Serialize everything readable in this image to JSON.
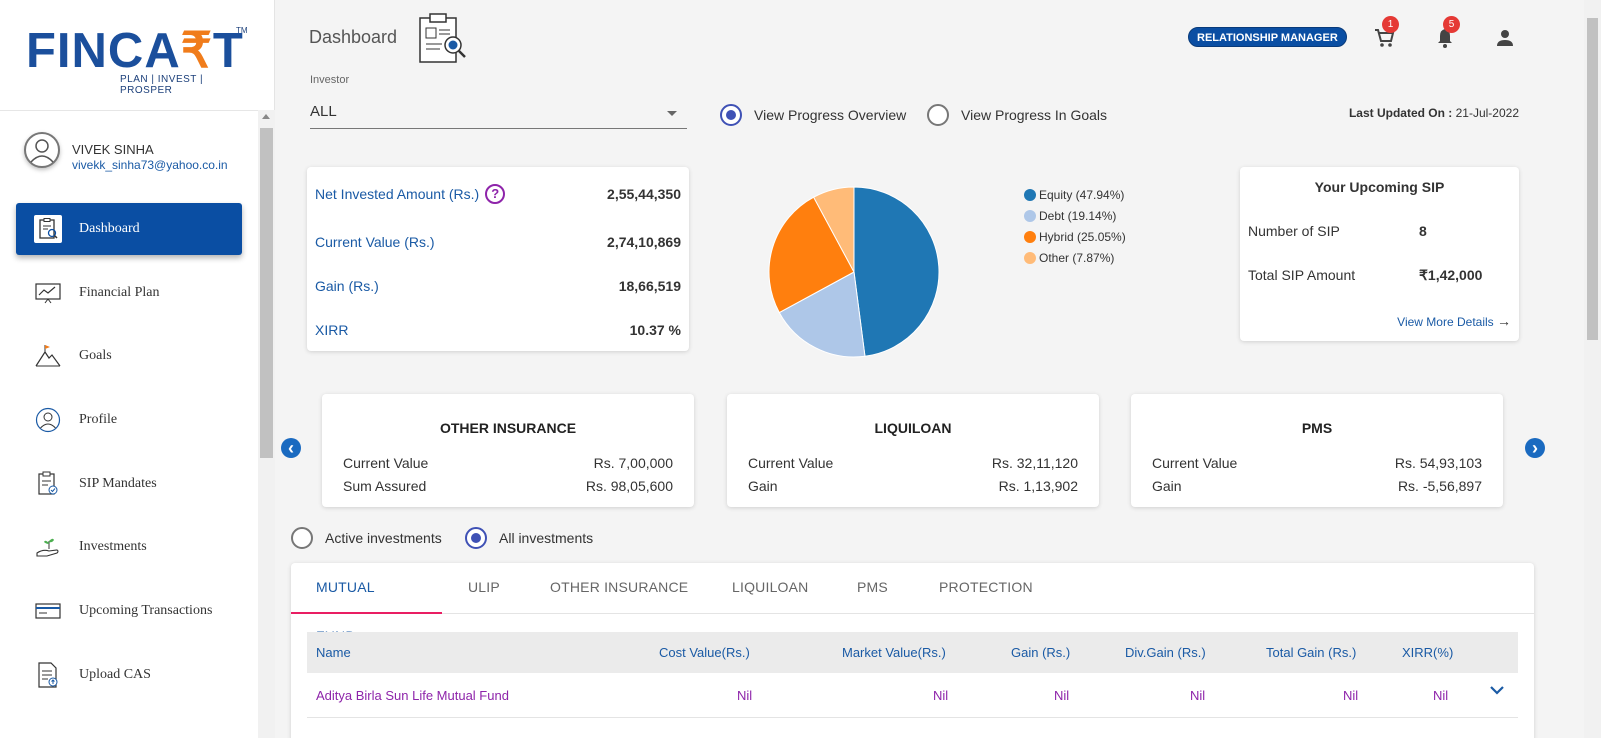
{
  "brand": {
    "name_part1": "FINCA",
    "name_rupee": "₹",
    "name_part2": "T",
    "tagline": "PLAN | INVEST | PROSPER",
    "tm": "TM",
    "primary_color": "#0a4ea3",
    "accent_color": "#f07c1b"
  },
  "user": {
    "name": "VIVEK SINHA",
    "email": "vivekk_sinha73@yahoo.co.in"
  },
  "sidebar": {
    "items": [
      {
        "label": "Dashboard",
        "icon": "dashboard-clipboard-icon",
        "active": true
      },
      {
        "label": "Financial Plan",
        "icon": "chart-board-icon"
      },
      {
        "label": "Goals",
        "icon": "mountain-flag-icon"
      },
      {
        "label": "Profile",
        "icon": "profile-icon"
      },
      {
        "label": "SIP Mandates",
        "icon": "clipboard-check-icon"
      },
      {
        "label": "Investments",
        "icon": "hand-plant-icon"
      },
      {
        "label": "Upcoming Transactions",
        "icon": "card-icon"
      },
      {
        "label": "Upload CAS",
        "icon": "document-upload-icon"
      }
    ]
  },
  "header": {
    "title": "Dashboard",
    "role_badge": "RELATIONSHIP MANAGER",
    "cart_count": "1",
    "notification_count": "5"
  },
  "investor": {
    "label": "Investor",
    "value": "ALL"
  },
  "view_options": {
    "overview": "View Progress Overview",
    "goals": "View Progress In Goals",
    "selected": "overview"
  },
  "last_updated": {
    "label": "Last Updated On :",
    "value": "21-Jul-2022"
  },
  "summary": {
    "rows": [
      {
        "label": "Net Invested Amount (Rs.)",
        "value": "2,55,44,350"
      },
      {
        "label": "Current Value (Rs.)",
        "value": "2,74,10,869"
      },
      {
        "label": "Gain (Rs.)",
        "value": "18,66,519"
      },
      {
        "label": "XIRR",
        "value": "10.37 %"
      }
    ],
    "help_symbol": "?"
  },
  "allocation": {
    "legend": [
      {
        "label": "Equity (47.94%)",
        "color": "#1f77b4"
      },
      {
        "label": "Debt (19.14%)",
        "color": "#aec7e8"
      },
      {
        "label": "Hybrid (25.05%)",
        "color": "#ff7f0e"
      },
      {
        "label": "Other (7.87%)",
        "color": "#ffbb78"
      }
    ]
  },
  "chart_data": {
    "type": "pie",
    "categories": [
      "Equity",
      "Debt",
      "Hybrid",
      "Other"
    ],
    "values": [
      47.94,
      19.14,
      25.05,
      7.87
    ],
    "colors": [
      "#1f77b4",
      "#aec7e8",
      "#ff7f0e",
      "#ffbb78"
    ],
    "legend_position": "right"
  },
  "sip": {
    "title": "Your Upcoming SIP",
    "count_label": "Number of SIP",
    "count_value": "8",
    "amount_label": "Total SIP Amount",
    "amount_value": "₹1,42,000",
    "more_label": "View More Details",
    "more_arrow": "→"
  },
  "carousel": {
    "prev_icon": "‹",
    "next_icon": "›",
    "cards": [
      {
        "title": "OTHER INSURANCE",
        "rows": [
          {
            "label": "Current Value",
            "value": "Rs. 7,00,000"
          },
          {
            "label": "Sum Assured",
            "value": "Rs. 98,05,600"
          }
        ]
      },
      {
        "title": "LIQUILOAN",
        "rows": [
          {
            "label": "Current Value",
            "value": "Rs. 32,11,120"
          },
          {
            "label": "Gain",
            "value": "Rs. 1,13,902"
          }
        ]
      },
      {
        "title": "PMS",
        "rows": [
          {
            "label": "Current Value",
            "value": "Rs. 54,93,103"
          },
          {
            "label": "Gain",
            "value": "Rs. -5,56,897"
          }
        ]
      }
    ]
  },
  "investment_filter": {
    "active": "Active investments",
    "all": "All investments",
    "selected": "all"
  },
  "tabs": [
    "MUTUAL FUND",
    "ULIP",
    "OTHER INSURANCE",
    "LIQUILOAN",
    "PMS",
    "PROTECTION"
  ],
  "table": {
    "columns": [
      "Name",
      "Cost Value(Rs.)",
      "Market Value(Rs.)",
      "Gain (Rs.)",
      "Div.Gain (Rs.)",
      "Total Gain (Rs.)",
      "XIRR(%)"
    ],
    "rows": [
      [
        "Aditya Birla Sun Life Mutual Fund",
        "Nil",
        "Nil",
        "Nil",
        "Nil",
        "Nil",
        "Nil"
      ]
    ],
    "row_color": "#8e24aa"
  }
}
